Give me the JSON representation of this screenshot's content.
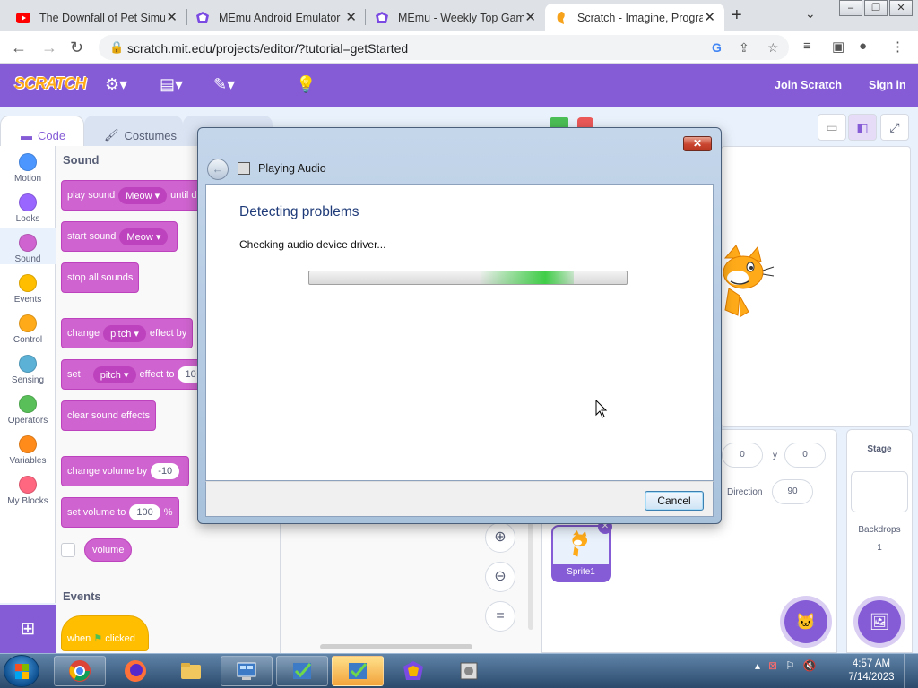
{
  "browser": {
    "tabs": [
      {
        "title": "The Downfall of Pet Simu",
        "icon": "youtube-icon"
      },
      {
        "title": "MEmu Android Emulator",
        "icon": "memu-icon"
      },
      {
        "title": "MEmu - Weekly Top Gam",
        "icon": "memu-icon"
      },
      {
        "title": "Scratch - Imagine, Progra",
        "icon": "scratch-icon",
        "active": true
      }
    ],
    "url": "scratch.mit.edu/projects/editor/?tutorial=getStarted"
  },
  "menubar": {
    "logo": "SCRATCH",
    "join_label": "Join Scratch",
    "signin_label": "Sign in"
  },
  "editor_tabs": {
    "code_label": "Code",
    "costumes_label": "Costumes"
  },
  "categories": [
    {
      "label": "Motion",
      "color": "#4c97ff"
    },
    {
      "label": "Looks",
      "color": "#9966ff"
    },
    {
      "label": "Sound",
      "color": "#cf63cf",
      "selected": true
    },
    {
      "label": "Events",
      "color": "#ffbf00"
    },
    {
      "label": "Control",
      "color": "#ffab19"
    },
    {
      "label": "Sensing",
      "color": "#5cb1d6"
    },
    {
      "label": "Operators",
      "color": "#59c059"
    },
    {
      "label": "Variables",
      "color": "#ff8c1a"
    },
    {
      "label": "My Blocks",
      "color": "#ff6680"
    }
  ],
  "palette": {
    "sound_title": "Sound",
    "events_title": "Events",
    "play_sound": {
      "prefix": "play sound",
      "sound": "Meow",
      "suffix": "until d"
    },
    "start_sound": {
      "prefix": "start sound",
      "sound": "Meow"
    },
    "stop_all": "stop all sounds",
    "change_effect": {
      "prefix": "change",
      "effect": "pitch",
      "suffix": "effect by"
    },
    "set_effect": {
      "prefix": "set",
      "effect": "pitch",
      "suffix": "effect to",
      "value": "10"
    },
    "clear_effects": "clear sound effects",
    "change_volume": {
      "label": "change volume by",
      "value": "-10"
    },
    "set_volume": {
      "label": "set volume to",
      "value": "100",
      "unit": "%"
    },
    "volume_reporter": "volume",
    "when_clicked": {
      "prefix": "when",
      "suffix": "clicked"
    }
  },
  "sprite_info": {
    "x_value": "0",
    "y_label": "y",
    "y_value": "0",
    "direction_label": "Direction",
    "direction_value": "90",
    "sprite_name": "Sprite1"
  },
  "stage_pane": {
    "title": "Stage",
    "backdrops_label": "Backdrops",
    "backdrops_count": "1"
  },
  "dialog": {
    "title": "Playing Audio",
    "heading": "Detecting problems",
    "status": "Checking audio device driver...",
    "cancel_label": "Cancel",
    "progress_glow": 0.73
  },
  "taskbar": {
    "time": "4:57 AM",
    "date": "7/14/2023"
  }
}
